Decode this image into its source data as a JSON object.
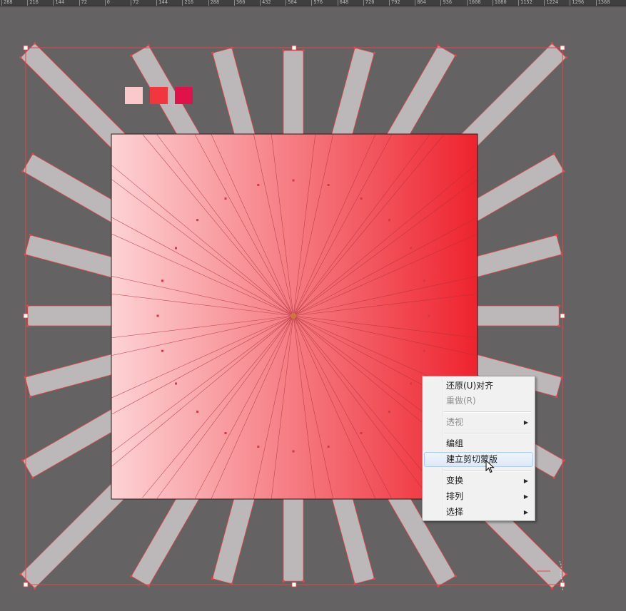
{
  "ruler": {
    "labels": [
      "288",
      "216",
      "144",
      "72",
      "0",
      "72",
      "144",
      "216",
      "288",
      "360",
      "432",
      "504",
      "576",
      "648",
      "720",
      "792",
      "864",
      "936",
      "1008",
      "1080",
      "1152",
      "1224",
      "1296",
      "1368"
    ]
  },
  "swatches": [
    {
      "name": "light-pink",
      "color": "#fbc8cb"
    },
    {
      "name": "coral-red",
      "color": "#f2363f"
    },
    {
      "name": "crimson",
      "color": "#e0124a"
    }
  ],
  "artwork": {
    "gradient_start": "#fdd2d4",
    "gradient_end": "#ee232e",
    "ray_fill": "#bcb8ba",
    "selection_color": "#e2474c",
    "ray_count": 24
  },
  "context_menu": {
    "items": [
      {
        "label": "还原(U)对齐",
        "enabled": true
      },
      {
        "label": "重做(R)",
        "enabled": false
      },
      {
        "label": "透视",
        "enabled": false,
        "submenu": true
      },
      {
        "label": "编组",
        "enabled": true
      },
      {
        "label": "建立剪切蒙版",
        "enabled": true,
        "hovered": true
      },
      {
        "label": "变换",
        "enabled": true,
        "submenu": true
      },
      {
        "label": "排列",
        "enabled": true,
        "submenu": true
      },
      {
        "label": "选择",
        "enabled": true,
        "submenu": true
      }
    ]
  },
  "icons": {
    "cursor": "arrow-cursor-icon",
    "submenu": "submenu-arrow-icon"
  }
}
